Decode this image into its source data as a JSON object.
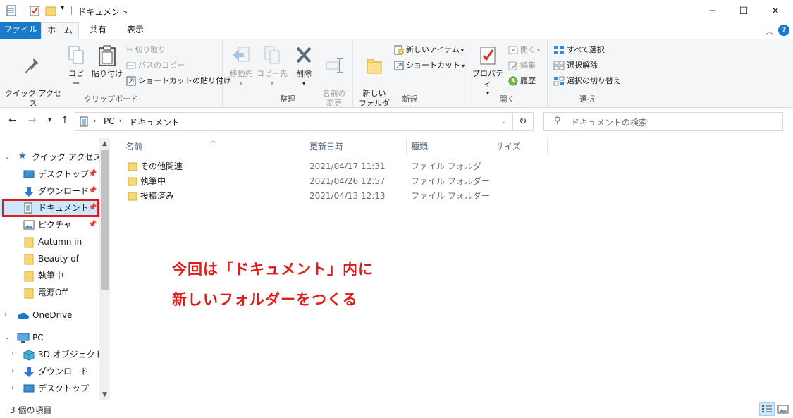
{
  "window": {
    "title": "ドキュメント",
    "minimize": "─",
    "maximize": "☐",
    "close": "✕"
  },
  "ribbon_tabs": [
    "ファイル",
    "ホーム",
    "共有",
    "表示"
  ],
  "ribbon": {
    "clipboard": {
      "label": "クリップボード",
      "pin_quick_access": "クイック アクセス\nにピン留めする",
      "copy": "コピー",
      "paste": "貼り付け",
      "cut": "切り取り",
      "copy_path": "パスのコピー",
      "paste_shortcut": "ショートカットの貼り付け"
    },
    "organize": {
      "label": "整理",
      "move_to": "移動先",
      "copy_to": "コピー先",
      "delete": "削除",
      "rename": "名前の\n変更"
    },
    "new": {
      "label": "新規",
      "new_folder": "新しい\nフォルダー",
      "new_item": "新しいアイテム",
      "easy_access": "ショートカット"
    },
    "open": {
      "label": "開く",
      "properties": "プロパティ",
      "open": "開く",
      "edit": "編集",
      "history": "履歴"
    },
    "select": {
      "label": "選択",
      "select_all": "すべて選択",
      "select_none": "選択解除",
      "invert": "選択の切り替え"
    }
  },
  "address": {
    "path": [
      "PC",
      "ドキュメント"
    ],
    "search_placeholder": "ドキュメントの検索"
  },
  "nav_pane": {
    "quick_access": "クイック アクセス",
    "items": [
      {
        "label": "デスクトップ",
        "pinned": true
      },
      {
        "label": "ダウンロード",
        "pinned": true
      },
      {
        "label": "ドキュメント",
        "pinned": true,
        "selected": true
      },
      {
        "label": "ピクチャ",
        "pinned": true
      },
      {
        "label": "Autumn in",
        "pinned": false
      },
      {
        "label": "Beauty of",
        "pinned": false
      },
      {
        "label": "執筆中",
        "pinned": false
      },
      {
        "label": "電源Off",
        "pinned": false
      }
    ],
    "onedrive": "OneDrive",
    "pc": "PC",
    "pc_items": [
      "3D オブジェクト",
      "ダウンロード",
      "デスクトップ"
    ]
  },
  "columns": {
    "name": "名前",
    "date": "更新日時",
    "type": "種類",
    "size": "サイズ"
  },
  "files": [
    {
      "name": "その他関連",
      "date": "2021/04/17 11:31",
      "type": "ファイル フォルダー"
    },
    {
      "name": "執筆中",
      "date": "2021/04/26 12:57",
      "type": "ファイル フォルダー"
    },
    {
      "name": "投稿済み",
      "date": "2021/04/13 12:13",
      "type": "ファイル フォルダー"
    }
  ],
  "annotation": {
    "line1": "今回は「ドキュメント」内に",
    "line2": "新しいフォルダーをつくる",
    "color": "#e01919"
  },
  "status": {
    "item_count": "3 個の項目"
  },
  "colors": {
    "accent": "#1979ca",
    "folder": "#f8d775",
    "highlight": "#e01919"
  }
}
